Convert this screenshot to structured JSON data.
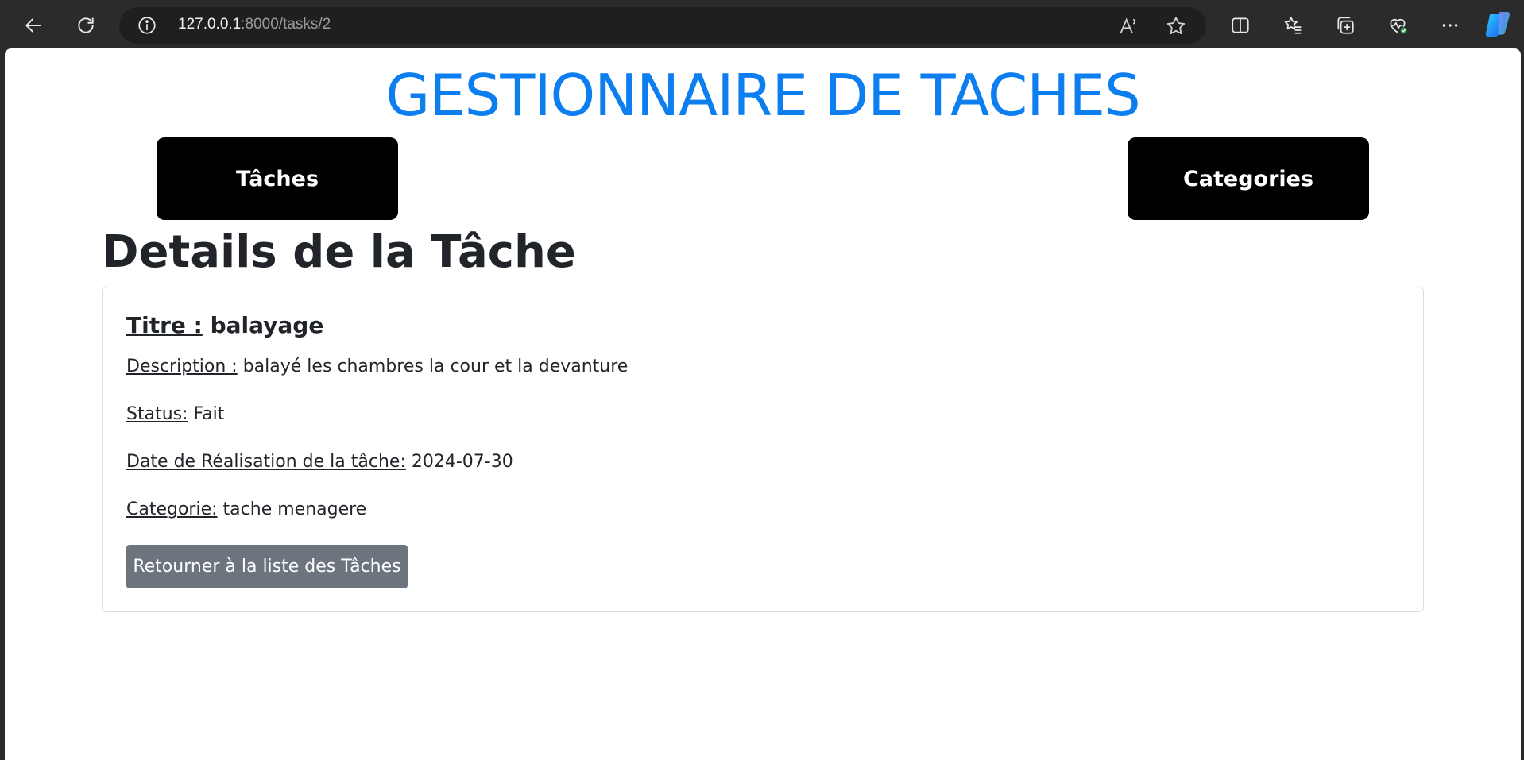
{
  "browser": {
    "url_host": "127.0.0.1",
    "url_rest": ":8000/tasks/2",
    "icons": [
      "back-icon",
      "refresh-icon",
      "info-icon",
      "read-aloud-icon",
      "favorite-star-icon",
      "split-screen-icon",
      "favorites-icon",
      "collections-icon",
      "browser-essentials-icon",
      "more-icon",
      "copilot-icon"
    ]
  },
  "site": {
    "title": "GESTIONNAIRE DE TACHES",
    "nav": {
      "tasks_label": "Tâches",
      "categories_label": "Categories"
    }
  },
  "page": {
    "heading": "Details de la Tâche"
  },
  "task": {
    "title_label": "Titre :",
    "title_value": "balayage",
    "description_label": "Description :",
    "description_value": "balayé les chambres la cour et la devanture",
    "status_label": "Status:",
    "status_value": "Fait",
    "date_label": "Date de Réalisation de la tâche:",
    "date_value": "2024-07-30",
    "category_label": "Categorie:",
    "category_value": "tache menagere"
  },
  "actions": {
    "back_label": "Retourner à la liste des Tâches"
  },
  "colors": {
    "accent_title": "#0d7ef0",
    "nav_button_bg": "#000000",
    "secondary_button_bg": "#6c757d"
  }
}
